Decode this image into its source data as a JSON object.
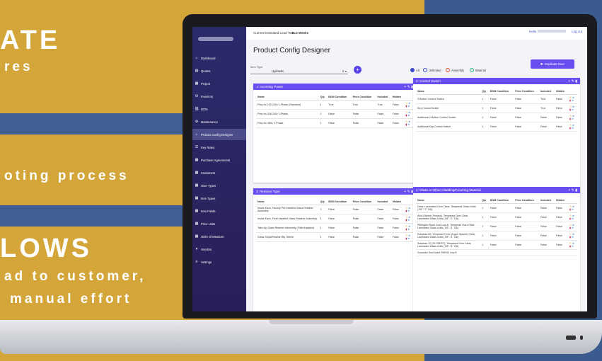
{
  "promo": {
    "line1": "ATE",
    "line2": "res",
    "line3": "oting process",
    "line4": "LOWS",
    "line5": "ad to customer,",
    "line6": "manual effort"
  },
  "topbar": {
    "lead_time_label": "Current Estimated Lead Time:",
    "lead_time_value": "31.2 Weeks",
    "hello": "Hello",
    "logout": "Log out"
  },
  "page": {
    "title": "Product Config Designer",
    "item_type_label": "Item Type",
    "item_type_value": "Hydraulic",
    "duplicate_label": "Duplicate Door",
    "filters": [
      "All",
      "Unlimited",
      "Assembly",
      "Material"
    ]
  },
  "sidebar": {
    "items": [
      {
        "label": "Dashboard",
        "icon": "home-icon"
      },
      {
        "label": "Quotes",
        "icon": "quotes-icon"
      },
      {
        "label": "Project",
        "icon": "project-icon"
      },
      {
        "label": "Inventory",
        "icon": "inventory-icon"
      },
      {
        "label": "BOM",
        "icon": "bom-icon"
      },
      {
        "label": "Maintenance",
        "icon": "gear-icon"
      },
      {
        "label": "Product Config Designer",
        "icon": "home-icon"
      },
      {
        "label": "Key Rates",
        "icon": "list-icon"
      },
      {
        "label": "Purchase Agreements",
        "icon": "grid-icon"
      },
      {
        "label": "Customers",
        "icon": "grid-icon"
      },
      {
        "label": "User Types",
        "icon": "grid-icon"
      },
      {
        "label": "Item Types",
        "icon": "grid-icon"
      },
      {
        "label": "Item Fields",
        "icon": "grid-icon"
      },
      {
        "label": "Price Units",
        "icon": "grid-icon"
      },
      {
        "label": "Units Of Measure",
        "icon": "grid-icon"
      },
      {
        "label": "Vendors",
        "icon": "chevron-down-icon"
      },
      {
        "label": "Settings",
        "icon": "menu-icon"
      }
    ]
  },
  "headers": [
    "Name",
    "Qty",
    "BOM Condition",
    "Price Condition",
    "Included",
    "Hidden"
  ],
  "cards": [
    {
      "title": "1: Incoming Power",
      "rows": [
        [
          "Prep for 220-240v 1-Phase (Standard)",
          "1",
          "True",
          "True",
          "True",
          "False"
        ],
        [
          "Prep for 208 240v 3-Phase",
          "1",
          "False",
          "False",
          "False",
          "False"
        ],
        [
          "Prep for 480v, 3 Phase",
          "1",
          "False",
          "False",
          "False",
          "False"
        ]
      ]
    },
    {
      "title": "2: Control Switch",
      "rows": [
        [
          "2-Button Control Switch",
          "1",
          "False",
          "False",
          "True",
          "False"
        ],
        [
          "Key Control Switch",
          "1",
          "False",
          "False",
          "True",
          "False"
        ],
        [
          "Additional 2-Button Control Switch",
          "1",
          "False",
          "False",
          "False",
          "False"
        ],
        [
          "Additional Key Control Switch",
          "1",
          "False",
          "False",
          "False",
          "False"
        ]
      ]
    },
    {
      "title": "3: Retainer Type",
      "rows": [
        [
          "Inside Each, Factory Pre-Installed Glass Retainer Assembly",
          "1",
          "False",
          "False",
          "False",
          "False"
        ],
        [
          "Inside Each, Field Installed Glass Retainer Assembly",
          "1",
          "False",
          "False",
          "False",
          "False"
        ],
        [
          "Take-Up Glass Retainer Assembly (Field Installed)",
          "1",
          "False",
          "False",
          "False",
          "False"
        ],
        [
          "Glass Stops/Retainer By Others",
          "1",
          "False",
          "False",
          "False",
          "False"
        ]
      ]
    },
    {
      "title": "4: Glass or Other Cladding/Covering Material",
      "rows": [
        [
          "Clear, Laminated Over Clear, Tempered Glass Units (7/8\" / 1\" OA)",
          "1",
          "False",
          "False",
          "False",
          "False"
        ],
        [
          "Acid-Etched (Frosted), Tempered Over Clear, Laminated Glass Units (7/8\" / 1\" OA)",
          "1",
          "False",
          "False",
          "False",
          "False"
        ],
        [
          "Pilkington Rosti Cool Low-E, Tempered Over Clear, Laminated Glass Units (7/8\" / 1\" OA)",
          "1",
          "False",
          "False",
          "False",
          "False"
        ],
        [
          "Solarban 60, Tempered Over (Argon Spacer) Clear, Laminated Glass Units (7/8\" / 1\" OA)",
          "1",
          "False",
          "False",
          "False",
          "False"
        ],
        [
          "Solarban 70 (XL-SB70T), Tempered Over Clear, Laminated Glass Units (7/8\" / 1\" OA)",
          "1",
          "False",
          "False",
          "False",
          "False"
        ],
        [
          "Guardian SunGuard SNR43 Low-E",
          "",
          "",
          "",
          "",
          ""
        ]
      ]
    }
  ],
  "colors": {
    "accent": "#6a4df0",
    "sidebar": "#2a2b6b",
    "gold": "#d4a63a",
    "blue": "#3b5b8e"
  }
}
